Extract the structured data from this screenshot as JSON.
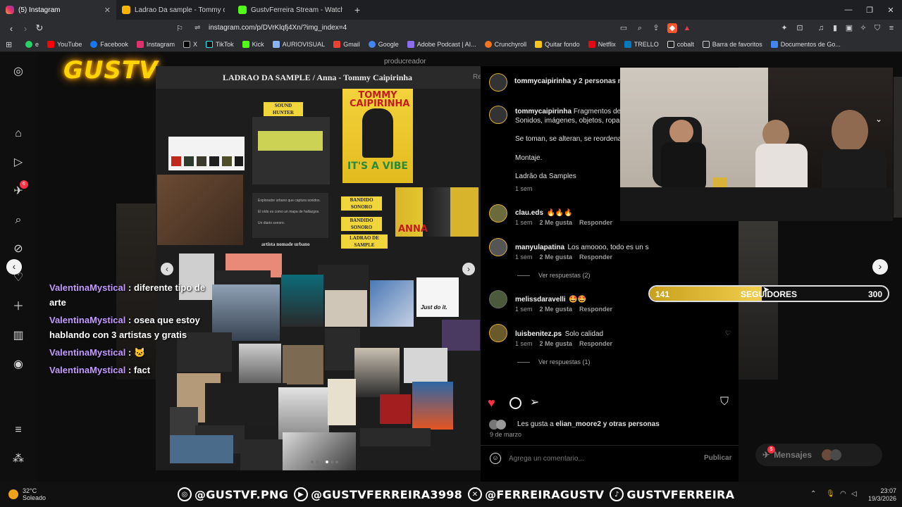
{
  "browser": {
    "tabs": [
      {
        "label": "(5) Instagram",
        "color": "#e1306c"
      },
      {
        "label": "Ladrao Da sample - Tommy caipirinh",
        "color": "#f4b400"
      },
      {
        "label": "GustvFerreira Stream - Watch Live",
        "color": "#53fc18"
      }
    ],
    "new_tab": "+",
    "url": "instagram.com/p/DVrKlqfj4Xn/?img_index=4",
    "bookmarks": [
      {
        "label": "e",
        "color": "#25d366"
      },
      {
        "label": "YouTube",
        "color": "#ff0000"
      },
      {
        "label": "Facebook",
        "color": "#1877f2"
      },
      {
        "label": "Instagram",
        "color": "#e1306c"
      },
      {
        "label": "X",
        "color": "#ffffff"
      },
      {
        "label": "TikTok",
        "color": "#25f4ee"
      },
      {
        "label": "Kick",
        "color": "#53fc18"
      },
      {
        "label": "AURIOVISUAL",
        "color": "#8ab4f8"
      },
      {
        "label": "Gmail",
        "color": "#ea4335"
      },
      {
        "label": "Google",
        "color": "#4285f4"
      },
      {
        "label": "Adobe Podcast | AI...",
        "color": "#8c6cf0"
      },
      {
        "label": "Crunchyroll",
        "color": "#f47521"
      },
      {
        "label": "Quitar fondo",
        "color": "#f5c518"
      },
      {
        "label": "Netflix",
        "color": "#e50914"
      },
      {
        "label": "TRELLO",
        "color": "#0079bf"
      },
      {
        "label": "cobalt",
        "color": "#ffffff"
      },
      {
        "label": "Barra de favoritos",
        "color": "#cccccc"
      },
      {
        "label": "Documentos de Go...",
        "color": "#4285f4"
      }
    ]
  },
  "stream_overlay": {
    "logo": "GUSTV",
    "producer_label": "producreador"
  },
  "post": {
    "title": "LADRAO DA SAMPLE / Anna - Tommy Caipirinha",
    "header_cut": "Re",
    "tags": [
      "SOUND HUNTER",
      "BANDIDO SONORO",
      "BANDIDO SONORO",
      "LADRAO DE SAMPLE"
    ],
    "nomad_label": "artista nomade urbano",
    "poster_text": "IT'S A VIBE",
    "poster_title": "TOMMY CAIPIRINHA",
    "poster_small": "ANNA",
    "explorer_lines": [
      "Explorador urbano que captura sonidos.",
      "El oído es como un mapa de hallazgos.",
      "Un diario sonoro."
    ],
    "justdoit": "Just do it."
  },
  "comments": {
    "header_user": "tommycaipirinha",
    "header_rest": "y 2 personas m",
    "caption_user": "tommycaipirinha",
    "caption_lines": [
      "Fragmentos de",
      "Sonidos, imágenes, objetos, ropa",
      "Se toman, se alteran, se reordena",
      "Montaje.",
      "Ladrão da Samples"
    ],
    "caption_time": "1 sem",
    "items": [
      {
        "user": "clau.eds",
        "text": "🔥🔥🔥",
        "time": "1 sem",
        "likes": "2 Me gusta",
        "reply": "Responder"
      },
      {
        "user": "manyulapatina",
        "text": "Los amoooo, todo es un s",
        "time": "1 sem",
        "likes": "2 Me gusta",
        "reply": "Responder",
        "more": "Ver respuestas (2)"
      },
      {
        "user": "melissdaravelli",
        "text": "🤩🤩",
        "time": "1 sem",
        "likes": "2 Me gusta",
        "reply": "Responder"
      },
      {
        "user": "luisbenitez.ps",
        "text": "Solo calidad",
        "time": "1 sem",
        "likes": "2 Me gusta",
        "reply": "Responder",
        "more": "Ver respuestas (1)"
      }
    ],
    "likes_text_prefix": "Les gusta a ",
    "likes_user": "elian_moore2",
    "likes_suffix": " y otras personas",
    "date": "9 de marzo",
    "add_comment_placeholder": "Agrega un comentario...",
    "publish": "Publicar"
  },
  "follower_goal": {
    "current": "141",
    "label": "SEGUIDORES",
    "goal": "300",
    "progress": 0.47
  },
  "chat": [
    {
      "nick": "ValentinaMystical",
      "msg": " : diferente tipo de",
      "msg2": "arte"
    },
    {
      "nick": "ValentinaMystical",
      "msg": " : osea que estoy",
      "msg2": "hablando con 3 artistas y gratis"
    },
    {
      "nick": "ValentinaMystical",
      "msg": " : 🐱",
      "msg2": ""
    },
    {
      "nick": "ValentinaMystical",
      "msg": " : fact",
      "msg2": ""
    }
  ],
  "messages_button": "Mensajes",
  "messages_badge": "5",
  "taskbar": {
    "temp": "32°C",
    "weather": "Soleado",
    "socials": [
      "@GUSTVF.PNG",
      "@GUSTVFERREIRA3998",
      "@FERREIRAGUSTV",
      "GUSTVFERREIRA"
    ],
    "time": "23:07",
    "date": "19/3/2026"
  }
}
